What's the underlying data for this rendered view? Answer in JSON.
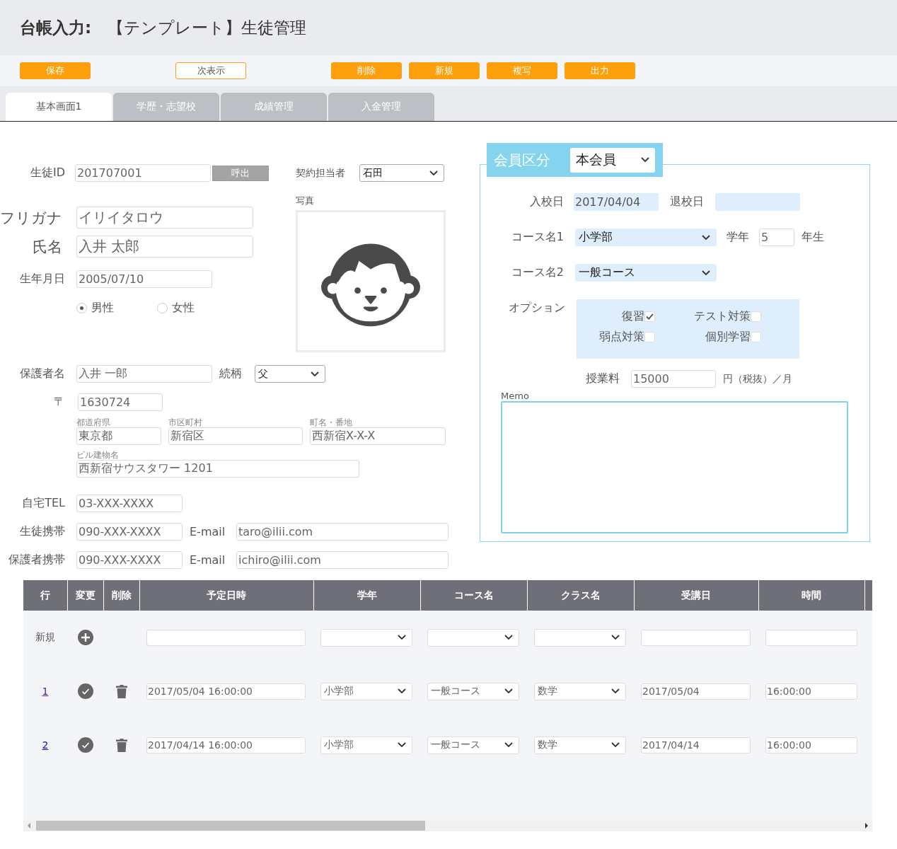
{
  "header": {
    "title": "**台帳入力:**　【テンプレート】生徒管理"
  },
  "toolbar": {
    "groups": [
      [
        {
          "label": "保存",
          "kind": "primary"
        }
      ],
      [
        {
          "label": "次表示",
          "kind": "outline"
        }
      ],
      [
        {
          "label": "削除",
          "kind": "primary"
        },
        {
          "label": "新規",
          "kind": "primary"
        },
        {
          "label": "複写",
          "kind": "primary"
        },
        {
          "label": "出力",
          "kind": "primary"
        }
      ]
    ]
  },
  "tabs": [
    {
      "label": "基本画面1",
      "selected": true
    },
    {
      "label": "学歴・志望校",
      "selected": false
    },
    {
      "label": "成績管理",
      "selected": false
    },
    {
      "label": "入金管理",
      "selected": false
    }
  ],
  "student": {
    "student_id": {
      "label": "生徒ID",
      "value": "201707001",
      "button": "呼出"
    },
    "contract_staff": {
      "label": "契約担当者",
      "value": "石田"
    },
    "photo": {
      "label": "写真"
    },
    "furigana": {
      "label": "フリガナ",
      "value": "イリイタロウ"
    },
    "name": {
      "label": "氏名",
      "value": "入井 太郎"
    },
    "birthdate": {
      "label": "生年月日",
      "value": "2005/07/10"
    },
    "gender": [
      {
        "label": "男性",
        "selected": true
      },
      {
        "label": "女性",
        "selected": false
      }
    ],
    "guardian": {
      "label": "保護者名",
      "value": "入井 一郎",
      "relation_label": "続柄",
      "relation": "父"
    },
    "postal": {
      "label": "〒",
      "value": "1630724"
    },
    "address": [
      {
        "label": "都道府県",
        "value": "東京都"
      },
      {
        "label": "市区町村",
        "value": "新宿区"
      },
      {
        "label": "町名・番地",
        "value": "西新宿X-X-X"
      }
    ],
    "building": {
      "label": "ビル建物名",
      "value": "西新宿サウスタワー 1201"
    },
    "home_tel": {
      "label": "自宅TEL",
      "value": "03-XXX-XXXX"
    },
    "phones": [
      {
        "label": "生徒携帯",
        "value": "090-XXX-XXXX",
        "email_label": "E-mail",
        "email": "taro@ilii.com"
      },
      {
        "label": "保護者携帯",
        "value": "090-XXX-XXXX",
        "email_label": "E-mail",
        "email": "ichiro@ilii.com"
      }
    ]
  },
  "membership": {
    "label": "会員区分",
    "value": "本会員",
    "enroll_date": {
      "label": "入校日",
      "value": "2017/04/04"
    },
    "leave_date": {
      "label": "退校日"
    },
    "course1": {
      "label": "コース名1",
      "value": "小学部"
    },
    "grade": {
      "label": "学年",
      "value": "5",
      "suffix": "年生"
    },
    "course2": {
      "label": "コース名2",
      "value": "一般コース"
    },
    "options": {
      "label": "オプション",
      "items": [
        {
          "label": "復習",
          "checked": true
        },
        {
          "label": "テスト対策",
          "checked": false
        },
        {
          "label": "弱点対策",
          "checked": false
        },
        {
          "label": "個別学習",
          "checked": false
        }
      ]
    },
    "fee": {
      "label": "授業料",
      "value": "15000",
      "suffix": "円（税抜）／月"
    },
    "memo": {
      "label": "Memo"
    }
  },
  "schedule": {
    "columns": [
      "行",
      "変更",
      "削除",
      "予定日時",
      "学年",
      "コース名",
      "クラス名",
      "受講日",
      "時間"
    ],
    "new_row": {
      "label": "新規"
    },
    "rows": [
      {
        "no": "1",
        "visited": true,
        "datetime": "2017/05/04 16:00:00",
        "grade": "小学部",
        "course": "一般コース",
        "class": "数学",
        "date": "2017/05/04",
        "time": "16:00:00"
      },
      {
        "no": "2",
        "visited": false,
        "datetime": "2017/04/14 16:00:00",
        "grade": "小学部",
        "course": "一般コース",
        "class": "数学",
        "date": "2017/04/14",
        "time": "16:00:00"
      }
    ]
  }
}
